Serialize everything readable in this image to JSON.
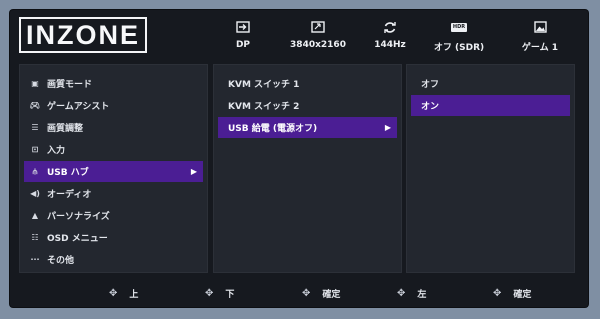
{
  "logo": {
    "text": "INZONE"
  },
  "status": [
    {
      "icon": "input-icon",
      "value": "DP"
    },
    {
      "icon": "resolution-icon",
      "value": "3840x2160"
    },
    {
      "icon": "refresh-rate-icon",
      "value": "144Hz"
    },
    {
      "icon": "hdr-icon",
      "icon_text": "HDR",
      "value": "オフ (SDR)"
    },
    {
      "icon": "picture-mode-icon",
      "value": "ゲーム 1"
    }
  ],
  "menu": [
    {
      "icon": "picture-mode-icon",
      "label": "画質モード"
    },
    {
      "icon": "gamepad-icon",
      "label": "ゲームアシスト"
    },
    {
      "icon": "sliders-icon",
      "label": "画質調整"
    },
    {
      "icon": "input-icon",
      "label": "入力"
    },
    {
      "icon": "usb-icon",
      "label": "USB ハブ",
      "selected": true
    },
    {
      "icon": "speaker-icon",
      "label": "オーディオ"
    },
    {
      "icon": "person-icon",
      "label": "パーソナライズ"
    },
    {
      "icon": "list-icon",
      "label": "OSD メニュー"
    },
    {
      "icon": "ellipsis-icon",
      "label": "その他"
    }
  ],
  "submenu": [
    {
      "label": "KVM スイッチ 1"
    },
    {
      "label": "KVM スイッチ 2"
    },
    {
      "label": "USB 給電 (電源オフ)",
      "selected": true
    }
  ],
  "options": [
    {
      "label": "オフ"
    },
    {
      "label": "オン",
      "selected": true
    }
  ],
  "nav": [
    {
      "icon": "dpad-icon",
      "label": "上"
    },
    {
      "icon": "dpad-icon",
      "label": "下"
    },
    {
      "icon": "dpad-icon",
      "label": "確定"
    },
    {
      "icon": "dpad-icon",
      "label": "左"
    },
    {
      "icon": "dpad-icon",
      "label": "確定"
    }
  ],
  "colors": {
    "selected": "#4b1e94",
    "panel": "#23272f",
    "screen": "#16191f"
  }
}
